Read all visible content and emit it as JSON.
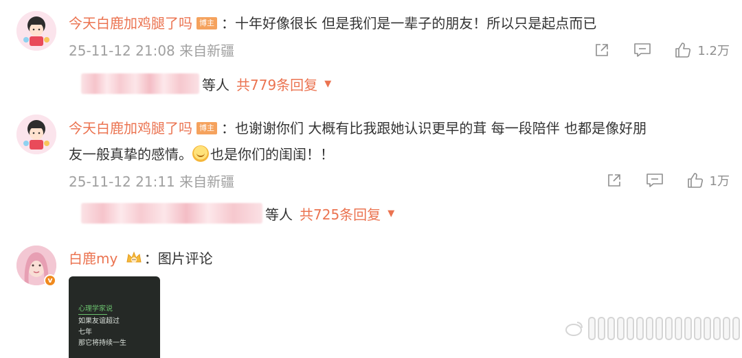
{
  "comments": [
    {
      "username": "今天白鹿加鸡腿了吗",
      "badge": "博主",
      "text": "十年好像很长 但是我们是一辈子的朋友！所以只是起点而已",
      "timestamp": "25-11-12 21:08",
      "location": "来自新疆",
      "likes": "1.2万",
      "replies_others": "等人",
      "replies_link": "共779条回复"
    },
    {
      "username": "今天白鹿加鸡腿了吗",
      "badge": "博主",
      "text_line1": "也谢谢你们 大概有比我跟她认识更早的茸 每一段陪伴 也都是像好朋",
      "text_line2_prefix": "友一般真挚的感情。",
      "text_line2_suffix": "也是你们的闺闺！！",
      "timestamp": "25-11-12 21:11",
      "location": "来自新疆",
      "likes": "1万",
      "replies_others": "等人",
      "replies_link": "共725条回复"
    },
    {
      "username": "白鹿my",
      "text": "图片评论",
      "image_lines": [
        "心理学家说",
        "如果友谊超过",
        "七年",
        "那它将持续一生"
      ]
    }
  ],
  "separator": "：",
  "icons": {
    "share": "share-icon",
    "comment": "comment-icon",
    "like": "thumbs-up-icon",
    "dropdown": "caret-down-icon",
    "verified": "verified-badge-icon"
  },
  "colors": {
    "username": "#eb7350",
    "meta": "#a0a0a0",
    "badge": "#f5a25d",
    "verified": "#f08a1e"
  }
}
